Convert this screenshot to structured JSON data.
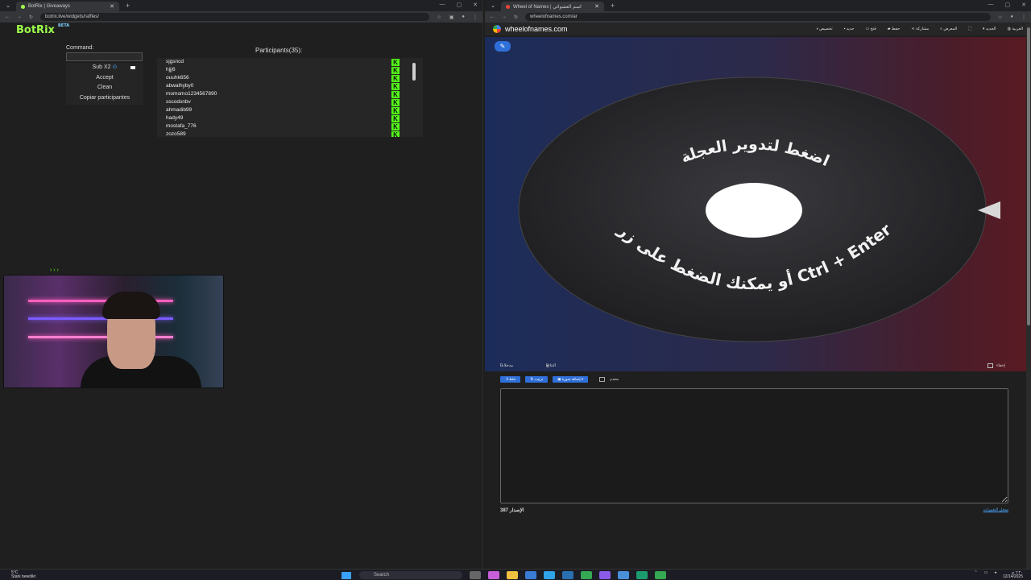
{
  "left_browser": {
    "tab_title": "BotRix | Giveaways",
    "url": "botrix.live/widgets/raffles/",
    "new_tab": "+",
    "close": "✕"
  },
  "right_browser": {
    "tab_title": "Wheel of Names | اسم العشوائي",
    "url": "wheelofnames.com/ar",
    "new_tab": "+",
    "close": "✕"
  },
  "botrix": {
    "brand": "BotRix",
    "beta": "BETA",
    "command_label": "Command:",
    "command_value": "",
    "panel_items": [
      "Sub X2",
      "Accept",
      "Clean",
      "Copiar participantes"
    ],
    "participants_title": "Participants(35):",
    "participants": [
      "sjgsncd",
      "hjjj6",
      "ouuhk656",
      "abwalhyby0",
      "momomo1234567890",
      "sscodsnbv",
      "ahmadib99",
      "hady49",
      "mostafa_776",
      "zozo589"
    ],
    "kick_badge": "K"
  },
  "stream_marker": "› › ›",
  "wheel": {
    "site_name": "wheelofnames.com",
    "nav": [
      "العربية",
      "الجديد",
      "",
      "المعرض",
      "مشاركة",
      "حفظ",
      "فتح",
      "جديد",
      "تخصيص"
    ],
    "wheel_text_top": "اضغط لتدوير العجلة",
    "wheel_text_bottom": "أو يمكنك الضغط على زر Ctrl + Enter",
    "tab_entries": "مدخلات",
    "tab_entries_count": "0",
    "tab_results": "النتائج",
    "tab_results_count": "0",
    "hide_label": "إخفاء",
    "btn_shuffle": "خلط",
    "btn_sort": "ترتيب",
    "btn_add_image": "إضافة صورة",
    "advanced_label": "متقدم",
    "entries_text": "",
    "footer_left": "387 الإصدار",
    "footer_right": "سجل التغييرات"
  },
  "taskbar": {
    "weather_temp": "5°C",
    "weather_desc": "Stark bewölkt",
    "search_placeholder": "Search",
    "clock_time": "٦:٢٠ م",
    "clock_date": "12/14/2025"
  },
  "colors": {
    "kick_green": "#53fc18",
    "accent_blue": "#2f6fd8"
  }
}
